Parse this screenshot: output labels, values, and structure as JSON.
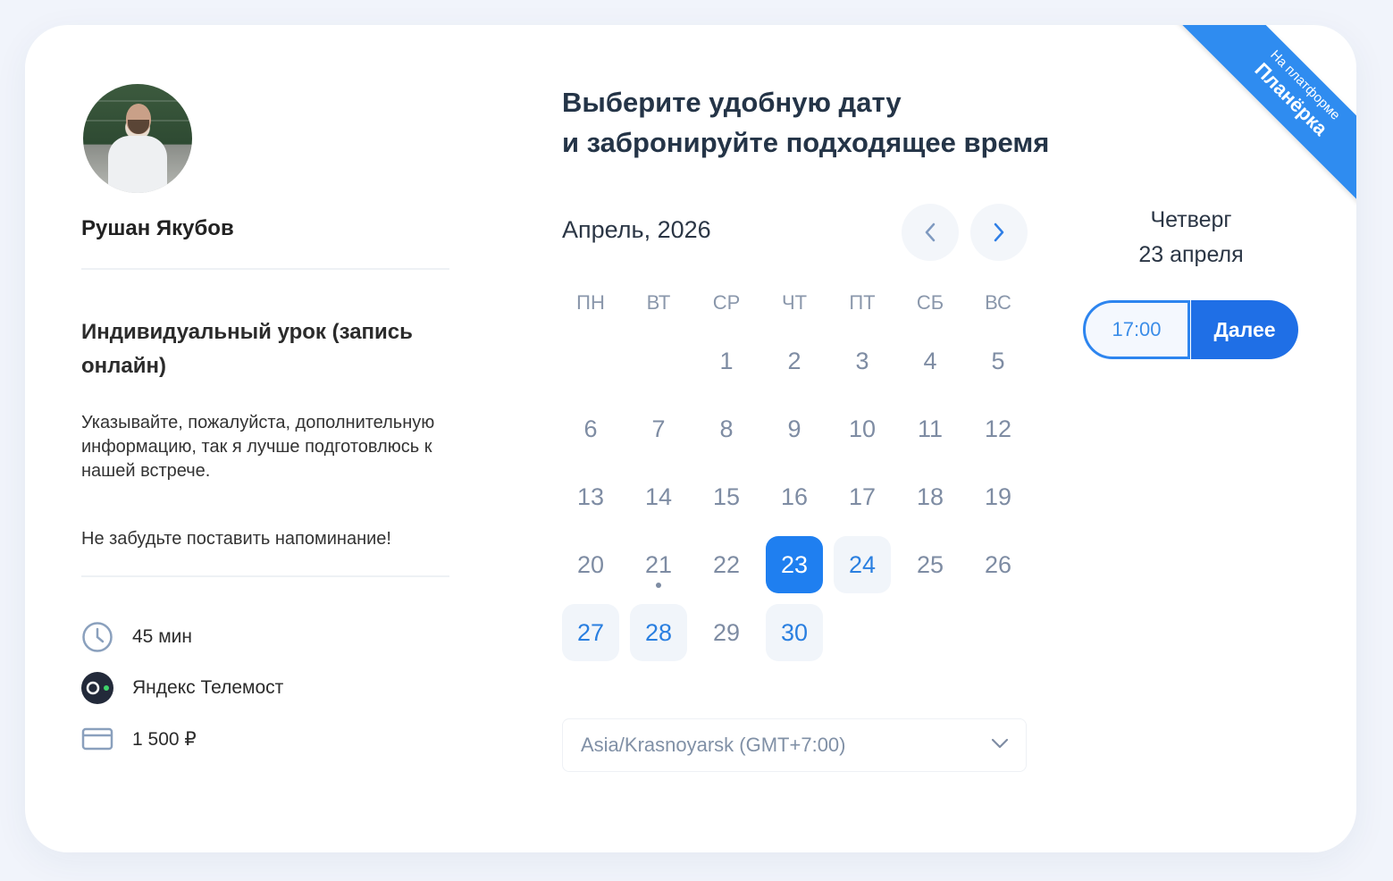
{
  "ribbon": {
    "line1": "На платформе",
    "line2": "Планёрка"
  },
  "host": {
    "name": "Рушан Якубов"
  },
  "event": {
    "title": "Индивидуальный урок (запись онлайн)",
    "description": "Указывайте, пожалуйста, дополнительную информацию, так я лучше подготовлюсь к нашей встрече.",
    "reminder": "Не забудьте поставить напоминание!"
  },
  "meta": {
    "duration": "45 мин",
    "platform": "Яндекс Телемост",
    "price": "1 500 ₽"
  },
  "heading": {
    "line1": "Выберите удобную дату",
    "line2": "и забронируйте подходящее время"
  },
  "calendar": {
    "month_label": "Апрель, 2026",
    "weekdays": [
      "ПН",
      "ВТ",
      "СР",
      "ЧТ",
      "ПТ",
      "СБ",
      "ВС"
    ],
    "first_weekday_index": 2,
    "days_in_month": 30,
    "today": 21,
    "selected": 23,
    "available": [
      23,
      24,
      27,
      28,
      30
    ]
  },
  "timezone": {
    "value": "Asia/Krasnoyarsk (GMT+7:00)"
  },
  "selection": {
    "weekday": "Четверг",
    "date": "23 апреля",
    "time_slot": "17:00",
    "next_label": "Далее"
  },
  "colors": {
    "accent": "#1f7ff0",
    "ribbon": "#2f8cf0",
    "muted": "#7e8ca3"
  }
}
